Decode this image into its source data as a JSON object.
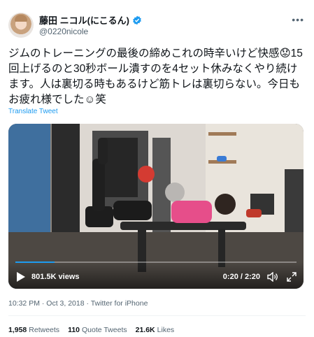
{
  "author": {
    "display_name": "藤田 ニコル(にこるん)",
    "handle": "@0220nicole"
  },
  "tweet": {
    "text": "ジムのトレーニングの最後の締めこれの時辛いけど快感😟15回上げるのと30秒ボール潰すのを4セット休みなくやり続けます。人は裏切る時もあるけど筋トレは裏切らない。今日もお疲れ様でした☺︎笑",
    "translate_label": "Translate Tweet"
  },
  "video": {
    "views": "801.5K views",
    "time": "0:20 / 2:20",
    "progress": 0.14
  },
  "meta": {
    "timestamp": "10:32 PM · Oct 3, 2018 · Twitter for iPhone"
  },
  "stats": {
    "retweets_count": "1,958",
    "retweets_label": "Retweets",
    "quotes_count": "110",
    "quotes_label": "Quote Tweets",
    "likes_count": "21.6K",
    "likes_label": "Likes"
  },
  "colors": {
    "accent": "#1d9bf0",
    "text": "#0f1419",
    "secondary": "#536471"
  },
  "icons": [
    "verified-badge-icon",
    "more-options-icon",
    "play-icon",
    "volume-icon",
    "fullscreen-icon"
  ]
}
